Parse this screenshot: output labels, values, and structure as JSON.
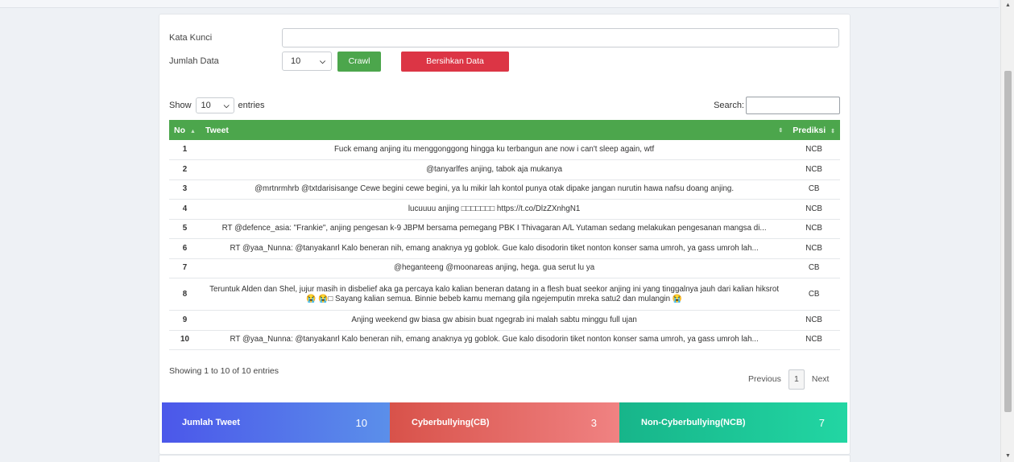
{
  "form": {
    "keyword_label": "Kata Kunci",
    "keyword_value": "",
    "count_label": "Jumlah Data",
    "count_value": "10",
    "crawl_label": "Crawl",
    "clear_label": "Bersihkan Data"
  },
  "datatable": {
    "show_label": "Show",
    "length_value": "10",
    "entries_label": "entries",
    "search_label": "Search:",
    "search_value": "",
    "columns": [
      "No",
      "Tweet",
      "Prediksi"
    ],
    "rows": [
      {
        "no": "1",
        "tweet": "Fuck emang anjing itu menggonggong hingga ku terbangun ane now i can't sleep again, wtf",
        "pred": "NCB"
      },
      {
        "no": "2",
        "tweet": "@tanyarlfes anjing, tabok aja mukanya",
        "pred": "NCB"
      },
      {
        "no": "3",
        "tweet": "@mrtnrmhrb @txtdarisisange Cewe begini cewe begini, ya lu mikir lah kontol punya otak dipake jangan nurutin hawa nafsu doang anjing.",
        "pred": "CB"
      },
      {
        "no": "4",
        "tweet": "lucuuuu anjing □□□□□□□ https://t.co/DlzZXnhgN1",
        "pred": "NCB"
      },
      {
        "no": "5",
        "tweet": "RT @defence_asia: \"Frankie\", anjing pengesan k-9 JBPM bersama pemegang PBK I Thivagaran A/L Yutaman sedang melakukan pengesanan mangsa di...",
        "pred": "NCB"
      },
      {
        "no": "6",
        "tweet": "RT @yaa_Nunna: @tanyakanrl Kalo beneran nih, emang anaknya yg goblok. Gue kalo disodorin tiket nonton konser sama umroh, ya gass umroh lah...",
        "pred": "NCB"
      },
      {
        "no": "7",
        "tweet": "@heganteeng @moonareas anjing, hega. gua serut lu ya",
        "pred": "CB"
      },
      {
        "no": "8",
        "tweet": "Teruntuk Alden dan Shel, jujur masih in disbelief aka ga percaya kalo kalian beneran datang in a flesh buat seekor anjing ini yang tinggalnya jauh dari kalian hiksrot 😭 😭□ Sayang kalian semua. Binnie bebeb kamu memang gila ngejemputin mreka satu2 dan mulangin 😭",
        "pred": "CB"
      },
      {
        "no": "9",
        "tweet": "Anjing weekend gw biasa gw abisin buat ngegrab ini malah sabtu minggu full ujan",
        "pred": "NCB"
      },
      {
        "no": "10",
        "tweet": "RT @yaa_Nunna: @tanyakanrl Kalo beneran nih, emang anaknya yg goblok. Gue kalo disodorin tiket nonton konser sama umroh, ya gass umroh lah...",
        "pred": "NCB"
      }
    ],
    "info": "Showing 1 to 10 of 10 entries",
    "prev_label": "Previous",
    "current_page": "1",
    "next_label": "Next"
  },
  "stats": [
    {
      "label": "Jumlah Tweet",
      "value": "10"
    },
    {
      "label": "Cyberbullying(CB)",
      "value": "3"
    },
    {
      "label": "Non-Cyberbullying(NCB)",
      "value": "7"
    }
  ],
  "colors": {
    "green": "#4ca64c",
    "red": "#dc3545",
    "blue": "#4b57ea",
    "salmon": "#e06a62",
    "teal": "#1cc49a"
  }
}
